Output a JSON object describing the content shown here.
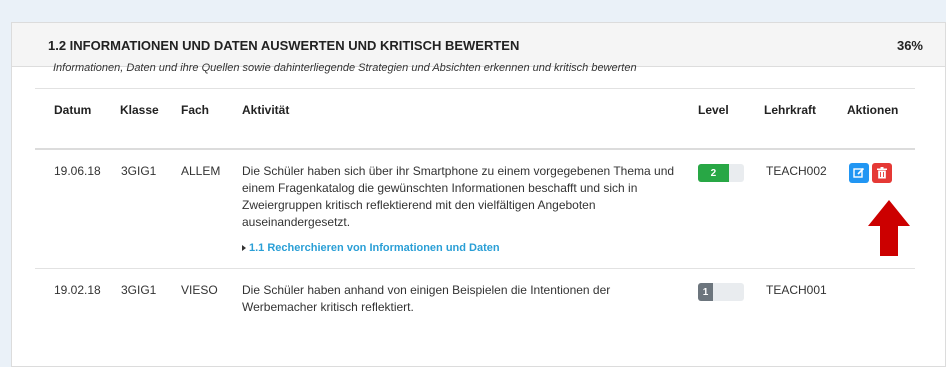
{
  "panel": {
    "title": "1.2 INFORMATIONEN UND DATEN AUSWERTEN UND KRITISCH BEWERTEN",
    "percent": "36%",
    "subtitle": "Informationen, Daten und ihre Quellen sowie dahinterliegende Strategien und Absichten erkennen und kritisch bewerten"
  },
  "table": {
    "headers": {
      "date": "Datum",
      "class": "Klasse",
      "subject": "Fach",
      "activity": "Aktivität",
      "level": "Level",
      "teacher": "Lehrkraft",
      "actions": "Aktionen"
    },
    "rows": [
      {
        "date": "19.06.18",
        "class": "3GIG1",
        "subject": "ALLEM",
        "activity_lines": [
          "Die Schüler haben sich über ihr Smartphone zu einem vorgegebenen Thema und",
          "einem Fragenkatalog die gewünschten Informationen beschafft und sich in",
          "Zweiergruppen kritisch reflektierend mit den vielfältigen Angeboten",
          "auseinandergesetzt."
        ],
        "link": "1.1 Recherchieren von Informationen und Daten",
        "level": "2",
        "level_fraction": 0.67,
        "level_color": "#28a745",
        "teacher": "TEACH002"
      },
      {
        "date": "19.02.18",
        "class": "3GIG1",
        "subject": "VIESO",
        "activity_lines": [
          "Die Schüler haben anhand von einigen Beispielen die Intentionen der",
          "Werbemacher kritisch reflektiert."
        ],
        "level": "1",
        "level_fraction": 0.33,
        "level_color": "#6c757d",
        "teacher": "TEACH001"
      }
    ]
  },
  "icons": {
    "edit": "edit-icon",
    "delete": "trash-icon",
    "arrow": "arrow-up-icon"
  },
  "colors": {
    "edit_button": "#2196f3",
    "delete_button": "#e53935",
    "arrow": "#cc0000",
    "link": "#2a9fd6"
  }
}
